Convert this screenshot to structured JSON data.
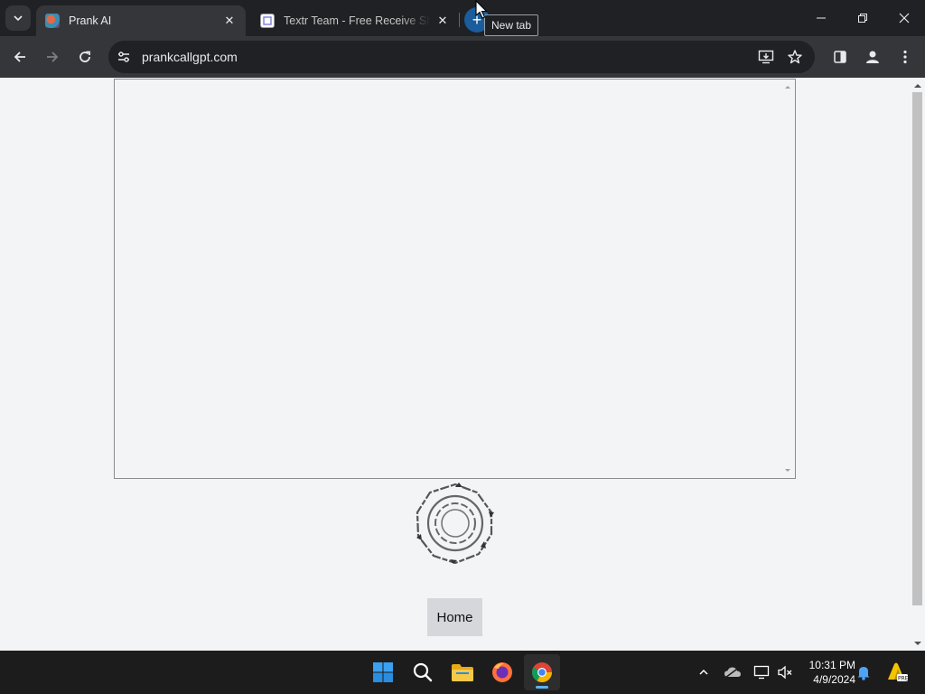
{
  "browser": {
    "tabs": [
      {
        "title": "Prank AI",
        "active": true
      },
      {
        "title": "Textr Team - Free Receive SMS Online",
        "active": false
      }
    ],
    "new_tab_tooltip": "New tab",
    "url": "prankcallgpt.com"
  },
  "page": {
    "home_button_label": "Home"
  },
  "taskbar": {
    "apps": [
      "windows-start",
      "search",
      "file-explorer",
      "firefox",
      "chrome"
    ],
    "time": "10:31 PM",
    "date": "4/9/2024"
  },
  "colors": {
    "chrome_dark": "#202124",
    "chrome_toolbar": "#35363a",
    "page_bg": "#f2f4f6",
    "button_bg": "#d5d7db",
    "taskbar_bg": "#1c1c1c"
  }
}
